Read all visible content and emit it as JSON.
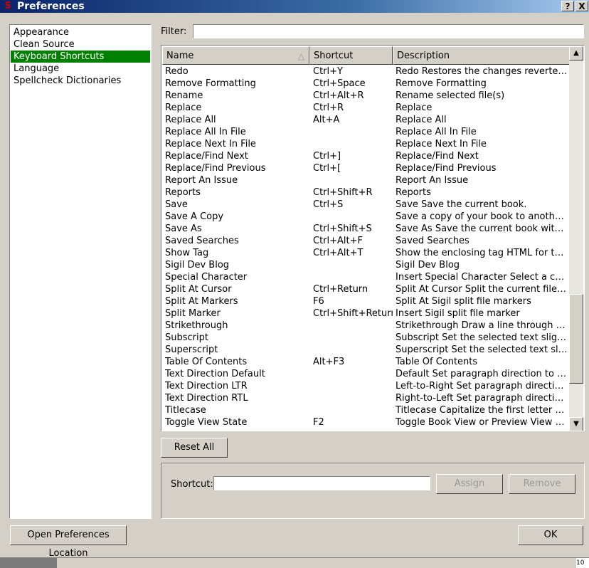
{
  "window": {
    "title": "Preferences",
    "help_glyph": "?",
    "close_glyph": "X",
    "icon_glyph": "S"
  },
  "categories": [
    {
      "label": "Appearance",
      "selected": false
    },
    {
      "label": "Clean Source",
      "selected": false
    },
    {
      "label": "Keyboard Shortcuts",
      "selected": true
    },
    {
      "label": "Language",
      "selected": false
    },
    {
      "label": "Spellcheck Dictionaries",
      "selected": false
    }
  ],
  "filter": {
    "label": "Filter:",
    "value": ""
  },
  "table": {
    "columns": [
      "Name",
      "Shortcut",
      "Description"
    ],
    "sort_glyph": "△",
    "rows": [
      {
        "name": "Redo",
        "shortcut": "Ctrl+Y",
        "description": "Redo Restores the changes reverted ..."
      },
      {
        "name": "Remove Formatting",
        "shortcut": "Ctrl+Space",
        "description": "Remove Formatting"
      },
      {
        "name": "Rename",
        "shortcut": "Ctrl+Alt+R",
        "description": "Rename selected file(s)"
      },
      {
        "name": "Replace",
        "shortcut": "Ctrl+R",
        "description": "Replace"
      },
      {
        "name": "Replace All",
        "shortcut": "Alt+A",
        "description": "Replace All"
      },
      {
        "name": "Replace All In File",
        "shortcut": "",
        "description": "Replace All In File"
      },
      {
        "name": "Replace Next In File",
        "shortcut": "",
        "description": "Replace Next In File"
      },
      {
        "name": "Replace/Find Next",
        "shortcut": "Ctrl+]",
        "description": "Replace/Find Next"
      },
      {
        "name": "Replace/Find Previous",
        "shortcut": "Ctrl+[",
        "description": "Replace/Find Previous"
      },
      {
        "name": "Report An Issue",
        "shortcut": "",
        "description": "Report An Issue"
      },
      {
        "name": "Reports",
        "shortcut": "Ctrl+Shift+R",
        "description": "Reports"
      },
      {
        "name": "Save",
        "shortcut": "Ctrl+S",
        "description": "Save Save the current book."
      },
      {
        "name": "Save A Copy",
        "shortcut": "",
        "description": "Save a copy of your book to another..."
      },
      {
        "name": "Save As",
        "shortcut": "Ctrl+Shift+S",
        "description": "Save As Save the current book with a..."
      },
      {
        "name": "Saved Searches",
        "shortcut": "Ctrl+Alt+F",
        "description": "Saved Searches"
      },
      {
        "name": "Show Tag",
        "shortcut": "Ctrl+Alt+T",
        "description": "Show the enclosing tag HTML for the ..."
      },
      {
        "name": "Sigil Dev Blog",
        "shortcut": "",
        "description": "Sigil Dev Blog"
      },
      {
        "name": "Special Character",
        "shortcut": "",
        "description": "Insert Special Character Select a char..."
      },
      {
        "name": "Split At Cursor",
        "shortcut": "Ctrl+Return",
        "description": "Split At Cursor Split the current file int..."
      },
      {
        "name": "Split At Markers",
        "shortcut": "F6",
        "description": "Split At Sigil split file markers"
      },
      {
        "name": "Split Marker",
        "shortcut": "Ctrl+Shift+Return",
        "description": "Insert Sigil split file marker"
      },
      {
        "name": "Strikethrough",
        "shortcut": "",
        "description": "Strikethrough Draw a line through th..."
      },
      {
        "name": "Subscript",
        "shortcut": "",
        "description": "Subscript Set the selected text slightl..."
      },
      {
        "name": "Superscript",
        "shortcut": "",
        "description": "Superscript Set the selected text sligh..."
      },
      {
        "name": "Table Of Contents",
        "shortcut": "Alt+F3",
        "description": "Table Of Contents"
      },
      {
        "name": "Text Direction Default",
        "shortcut": "",
        "description": "Default Set paragraph direction to inh..."
      },
      {
        "name": "Text Direction LTR",
        "shortcut": "",
        "description": "Left-to-Right Set paragraph direction ..."
      },
      {
        "name": "Text Direction RTL",
        "shortcut": "",
        "description": "Right-to-Left Set paragraph direction ..."
      },
      {
        "name": "Titlecase",
        "shortcut": "",
        "description": "Titlecase Capitalize the first letter of ea..."
      },
      {
        "name": "Toggle View State",
        "shortcut": "F2",
        "description": "Toggle Book View or Preview View to ..."
      }
    ]
  },
  "scrollbar": {
    "up_glyph": "▲",
    "down_glyph": "▼"
  },
  "buttons": {
    "reset_all": "Reset All",
    "assign": "Assign",
    "remove": "Remove",
    "open_location": "Open Preferences Location",
    "ok": "OK"
  },
  "shortcut_editor": {
    "label": "Shortcut:",
    "value": ""
  },
  "taskbar": {
    "clock_fragment": "10"
  },
  "colors": {
    "selection": "#008000",
    "title_bar": "#0a246a",
    "dialog_bg": "#d4d0c8"
  }
}
